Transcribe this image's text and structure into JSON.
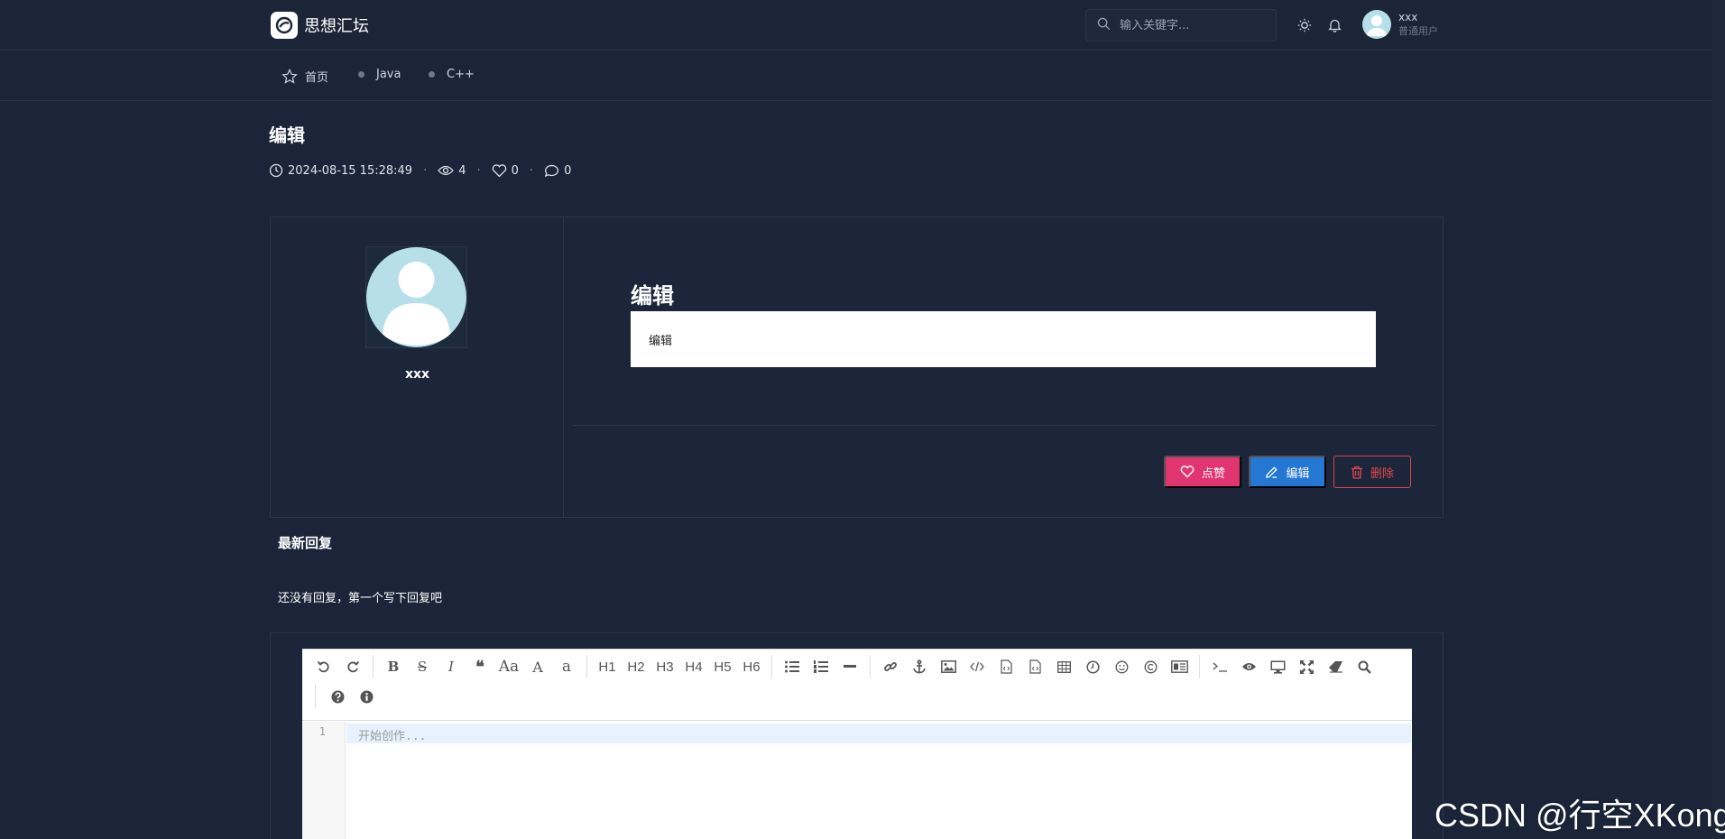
{
  "brand": {
    "name": "思想汇坛",
    "logo_icon": "brand-logo-icon"
  },
  "search": {
    "placeholder": "输入关键字..."
  },
  "user": {
    "name": "xxx",
    "role": "普通用户"
  },
  "nav": {
    "items": [
      {
        "label": "首页",
        "icon": "star-icon"
      },
      {
        "label": "Java",
        "icon": "dot"
      },
      {
        "label": "C++",
        "icon": "dot"
      }
    ]
  },
  "post": {
    "title": "编辑",
    "date": "2024-08-15 15:28:49",
    "views": "4",
    "likes": "0",
    "comments": "0",
    "author": "xxx",
    "content_title": "编辑",
    "content_body": "编辑"
  },
  "actions": {
    "like": "点赞",
    "edit": "编辑",
    "delete": "删除"
  },
  "replies": {
    "title": "最新回复",
    "empty": "还没有回复，第一个写下回复吧"
  },
  "editor": {
    "toolbar_row1": [
      "B",
      "S",
      "I",
      "❝",
      "Aa",
      "A",
      "a",
      "H1",
      "H2",
      "H3",
      "H4",
      "H5",
      "H6"
    ],
    "line_number": "1",
    "placeholder": "开始创作..."
  },
  "watermark": "CSDN @行空XKong",
  "colors": {
    "background": "#1b2438",
    "like": "#e0356e",
    "edit": "#2577d4",
    "delete": "#e5484d"
  }
}
